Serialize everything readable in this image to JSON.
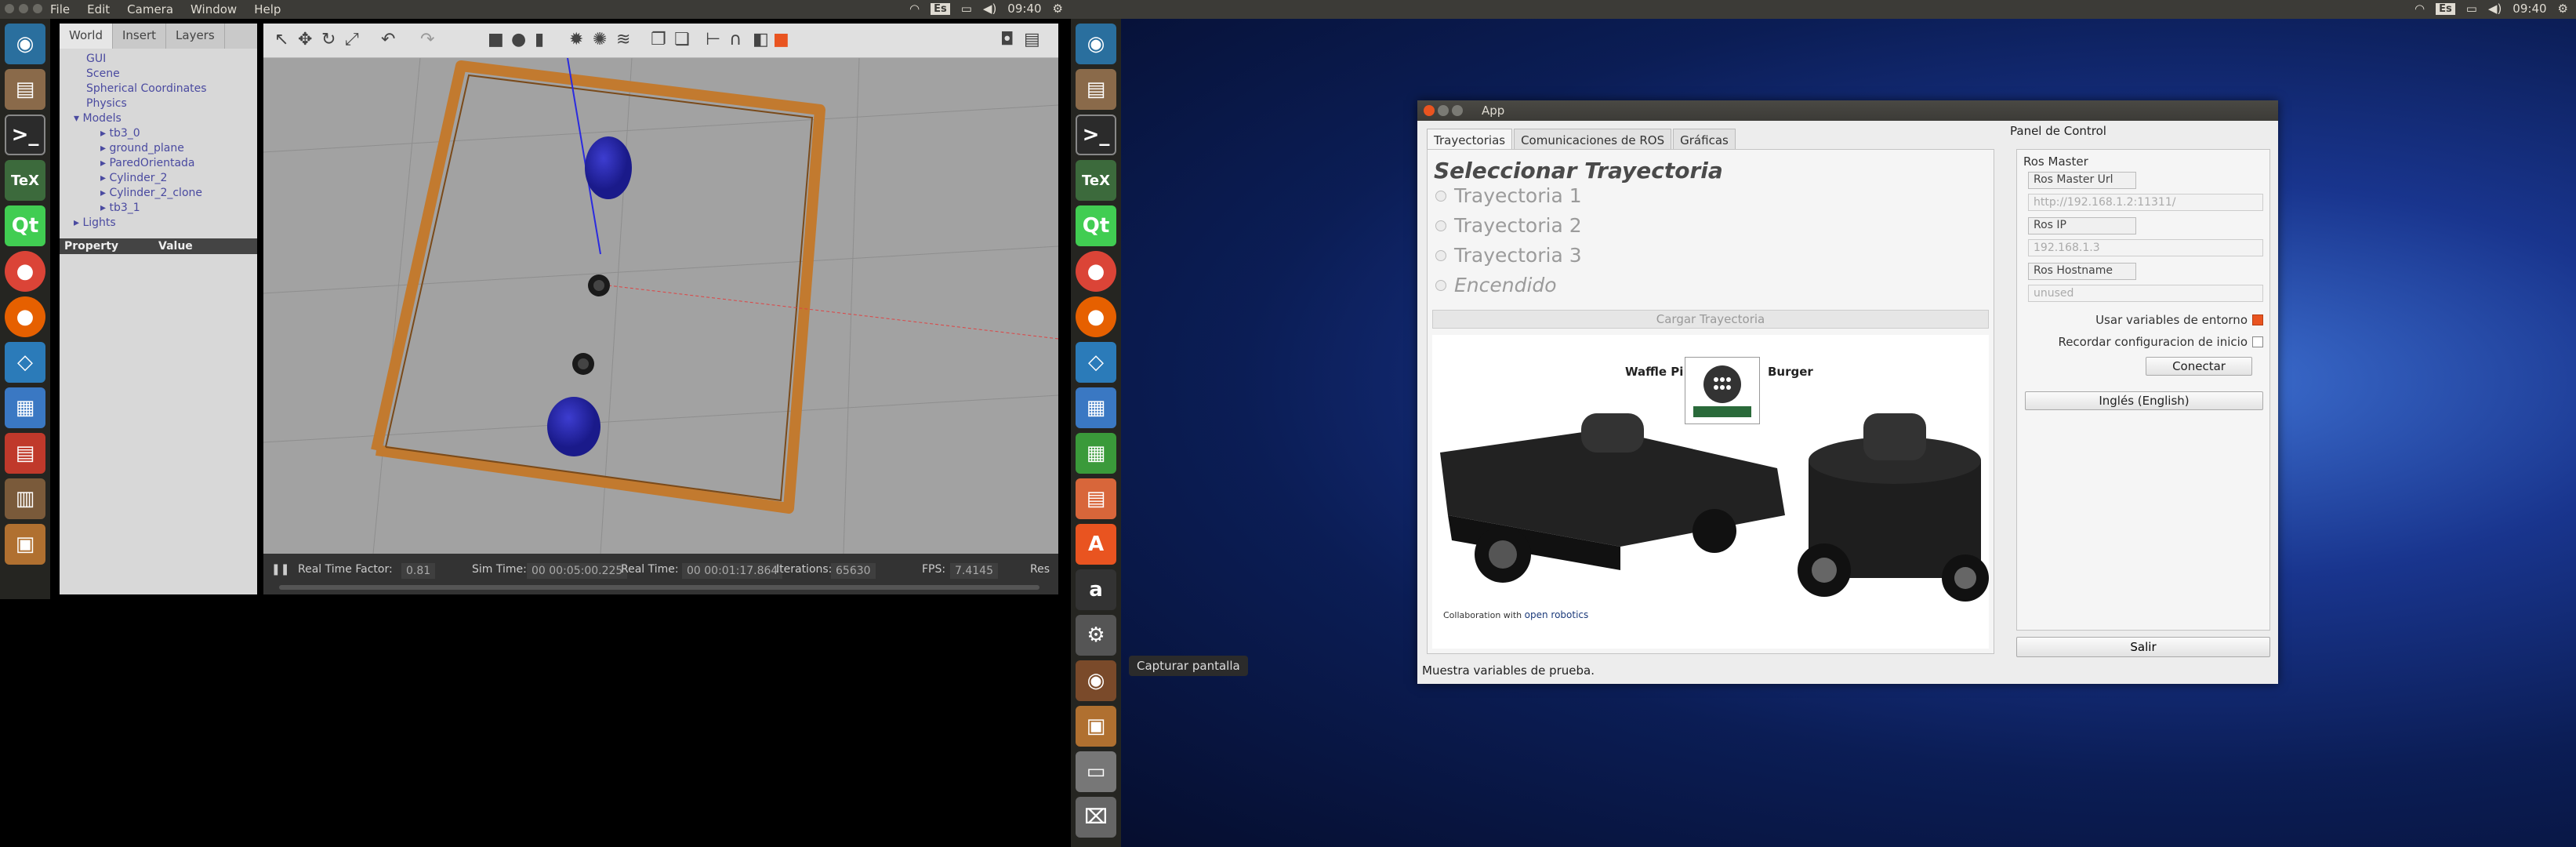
{
  "gazebo": {
    "menu": [
      "File",
      "Edit",
      "Camera",
      "Window",
      "Help"
    ],
    "tabs": [
      "World",
      "Insert",
      "Layers"
    ],
    "tree": {
      "items": [
        "GUI",
        "Scene",
        "Spherical Coordinates",
        "Physics"
      ],
      "models_label": "Models",
      "models": [
        "tb3_0",
        "ground_plane",
        "ParedOrientada",
        "Cylinder_2",
        "Cylinder_2_clone",
        "tb3_1"
      ],
      "lights_label": "Lights"
    },
    "property_header": {
      "property": "Property",
      "value": "Value"
    },
    "status": {
      "rtf_label": "Real Time Factor:",
      "rtf": "0.81",
      "sim_label": "Sim Time:",
      "sim": "00 00:05:00.225",
      "real_label": "Real Time:",
      "real": "00 00:01:17.864",
      "iter_label": "Iterations:",
      "iter": "65630",
      "fps_label": "FPS:",
      "fps": "7.4145",
      "reset": "Res"
    }
  },
  "tray_left": {
    "kbd": "Es",
    "time": "09:40"
  },
  "tray_right": {
    "kbd": "Es",
    "time": "09:40"
  },
  "tooltip": "Capturar pantalla",
  "app": {
    "title": "App",
    "tabs": [
      "Trayectorias",
      "Comunicaciones de ROS",
      "Gráficas"
    ],
    "heading": "Seleccionar Trayectoria",
    "radios": [
      "Trayectoria 1",
      "Trayectoria 2",
      "Trayectoria 3",
      "Encendido"
    ],
    "cargar": "Cargar Trayectoria",
    "robots": {
      "left": "Waffle Pi",
      "right": "Burger",
      "collab": "Collaboration with",
      "collab_brand": "open robotics"
    },
    "panel_title": "Panel de Control",
    "ros_master": "Ros Master",
    "fields": [
      {
        "label": "Ros Master Url",
        "value": "http://192.168.1.2:11311/"
      },
      {
        "label": "Ros IP",
        "value": "192.168.1.3"
      },
      {
        "label": "Ros Hostname",
        "value": "unused"
      }
    ],
    "checks": [
      {
        "label": "Usar variables de entorno",
        "checked": true
      },
      {
        "label": "Recordar configuracion de inicio",
        "checked": false
      }
    ],
    "connect": "Conectar",
    "language": "Inglés (English)",
    "exit": "Salir",
    "status": "Muestra variables de prueba."
  },
  "colors": {
    "accent": "#e95420",
    "panel_bg": "#ededed",
    "topbar": "#3c3b37"
  }
}
